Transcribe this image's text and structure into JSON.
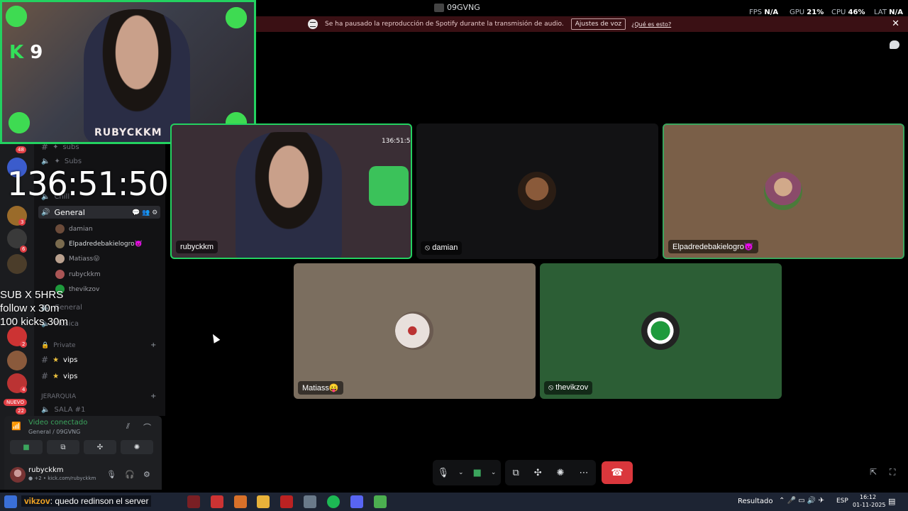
{
  "topbar": {
    "title": "09GVNG",
    "fps_label": "FPS",
    "fps_value": "N/A",
    "gpu_label": "GPU",
    "gpu_value": "21%",
    "cpu_label": "CPU",
    "cpu_value": "46%",
    "lat_label": "LAT",
    "lat_value": "N/A"
  },
  "notice": {
    "text": "Se ha pausado la reproducción de Spotify durante la transmisión de audio.",
    "button": "Ajustes de voz",
    "link": "¿Qué es esto?",
    "close": "✕"
  },
  "overlay": {
    "kick_logo": "K",
    "kick_num": "9",
    "cam_banner": "RUBYCKKM",
    "timer": "136:51:50",
    "sub_lines": [
      "SUB X 5HRS",
      "follow x 30m",
      "100 kicks 30m"
    ]
  },
  "servers": [
    {
      "badge": "48"
    },
    {
      "badge": ""
    },
    {
      "badge": "3"
    },
    {
      "badge": "6"
    },
    {
      "badge": ""
    },
    {
      "badge": ""
    },
    {
      "badge": "2"
    },
    {
      "badge": ""
    },
    {
      "badge": "4"
    },
    {
      "badge": "22"
    }
  ],
  "nuevo_label": "NUEVO",
  "channels": {
    "items": [
      {
        "label": "subs",
        "starred": true
      },
      {
        "label": "Subs",
        "starred": true
      },
      {
        "label": "Chill",
        "starred": false
      },
      {
        "label": "General",
        "starred": false
      }
    ],
    "members": [
      {
        "name": "damian",
        "color": "#6b4b3a"
      },
      {
        "name": "Elpadredebakielogro👿",
        "color": "#7a6b4e"
      },
      {
        "name": "Matiass😛",
        "color": "#b9a08e"
      },
      {
        "name": "rubyckkm",
        "color": "#a55"
      },
      {
        "name": "thevikzov",
        "color": "#1e9a3c"
      }
    ],
    "after": [
      {
        "label": "General"
      },
      {
        "label": "Música"
      }
    ],
    "private_header": "Private",
    "private_items": [
      {
        "label": "vips"
      },
      {
        "label": "vips"
      }
    ],
    "jerarquia_header": "JERARQUIA",
    "sala": "SALA #1"
  },
  "voice": {
    "status": "Video conectado",
    "channel": "General / 09GVNG"
  },
  "user": {
    "name": "rubyckkm",
    "sub": "● +2 • kick.com/rubyckkm"
  },
  "tiles": [
    {
      "name": "rubyckkm",
      "bg": "#3a2e35",
      "ts": "136:51:50"
    },
    {
      "name": "damian",
      "bg": "#121214",
      "muted": true
    },
    {
      "name": "Elpadredebakielogro👿",
      "bg": "#7a5f48"
    },
    {
      "name": "Matiass😛",
      "bg": "#7b6e5f"
    },
    {
      "name": "thevikzov",
      "bg": "#2c5e35",
      "muted": true
    }
  ],
  "taskbar": {
    "chat_user": "vikzov",
    "chat_text": ": quedo redinson el server",
    "result": "Resultado",
    "lang": "ESP",
    "time": "16:12",
    "date": "01-11-2025"
  },
  "colors": {
    "accent_green": "#23d160",
    "danger": "#da373c",
    "discord_bg": "#000000"
  }
}
